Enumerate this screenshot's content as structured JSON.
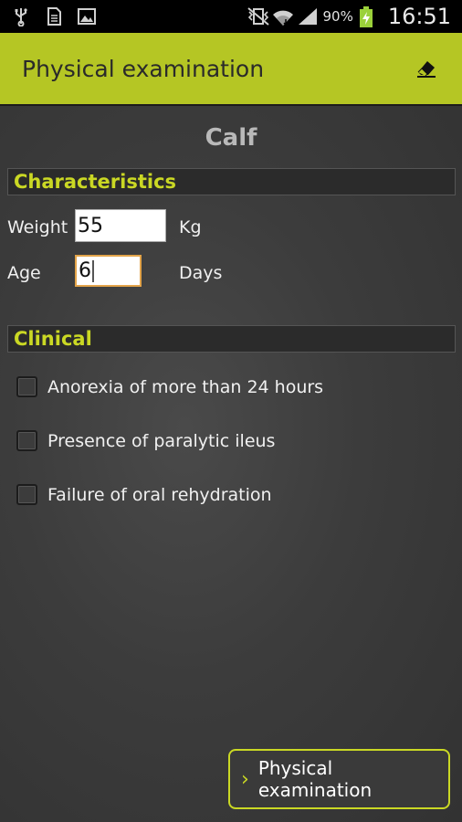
{
  "status_bar": {
    "icons": [
      "usb-icon",
      "sim-card-icon",
      "image-icon",
      "vibrate-mute-icon",
      "wifi-icon",
      "signal-icon",
      "battery-charging-icon"
    ],
    "battery_percent": "90%",
    "time": "16:51"
  },
  "action_bar": {
    "title": "Physical examination",
    "action_icon": "eraser-icon"
  },
  "animal": "Calf",
  "characteristics": {
    "header": "Characteristics",
    "weight_label": "Weight",
    "weight_value": "55",
    "weight_unit": "Kg",
    "age_label": "Age",
    "age_value": "6",
    "age_unit": "Days"
  },
  "clinical": {
    "header": "Clinical",
    "items": [
      {
        "label": "Anorexia of more than 24 hours",
        "checked": false
      },
      {
        "label": "Presence of paralytic ileus",
        "checked": false
      },
      {
        "label": "Failure of oral rehydration",
        "checked": false
      }
    ]
  },
  "bottom_button": {
    "label": "Physical examination"
  },
  "colors": {
    "accent": "#b5c624",
    "header_text": "#cad824",
    "focus": "#e3a44a"
  }
}
